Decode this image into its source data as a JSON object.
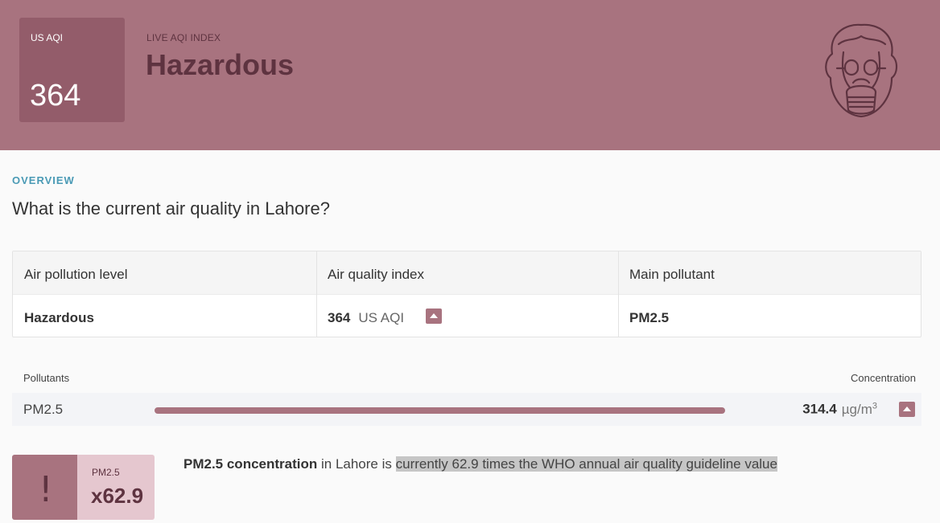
{
  "header": {
    "aqi_label": "US AQI",
    "aqi_value": "364",
    "live_label": "LIVE AQI INDEX",
    "status": "Hazardous",
    "icon": "gas-mask-icon",
    "color": "#a8737f"
  },
  "overview": {
    "label": "OVERVIEW",
    "question": "What is the current air quality in Lahore?"
  },
  "table": {
    "headers": [
      "Air pollution level",
      "Air quality index",
      "Main pollutant"
    ],
    "level": "Hazardous",
    "aqi_value": "364",
    "aqi_unit": "US AQI",
    "main_pollutant": "PM2.5"
  },
  "pollutants": {
    "header_left": "Pollutants",
    "header_right": "Concentration",
    "name": "PM2.5",
    "value": "314.4",
    "unit": "µg/m",
    "unit_sup": "3"
  },
  "who": {
    "icon_glyph": "!",
    "pollutant": "PM2.5",
    "factor": "x62.9",
    "text_bold": "PM2.5 concentration",
    "text_mid": " in Lahore is ",
    "text_highlight": "currently 62.9 times the WHO annual air quality guideline value"
  }
}
